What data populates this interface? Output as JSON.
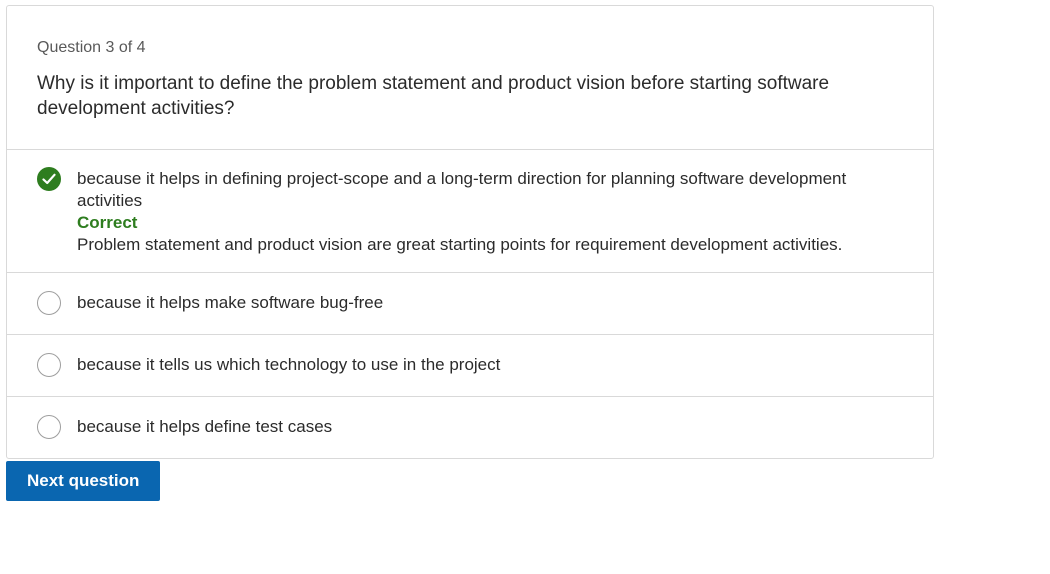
{
  "question": {
    "counter": "Question 3 of 4",
    "text": "Why is it important to define the problem statement and product vision before starting software development activities?"
  },
  "options": [
    {
      "label": "because it helps in defining project-scope and a long-term direction for planning software development activities",
      "selected": true,
      "feedback_status": "Correct",
      "feedback_text": "Problem statement and product vision are great starting points for requirement development activities."
    },
    {
      "label": "because it helps make software bug-free",
      "selected": false
    },
    {
      "label": "because it tells us which technology to use in the project",
      "selected": false
    },
    {
      "label": "because it helps define test cases",
      "selected": false
    }
  ],
  "actions": {
    "next_label": "Next question"
  },
  "colors": {
    "correct": "#2e7d1f",
    "primary_button": "#0a66b0"
  },
  "icons": {
    "selected_option": "checkmark-circle-icon",
    "unselected_option": "radio-empty-icon"
  }
}
